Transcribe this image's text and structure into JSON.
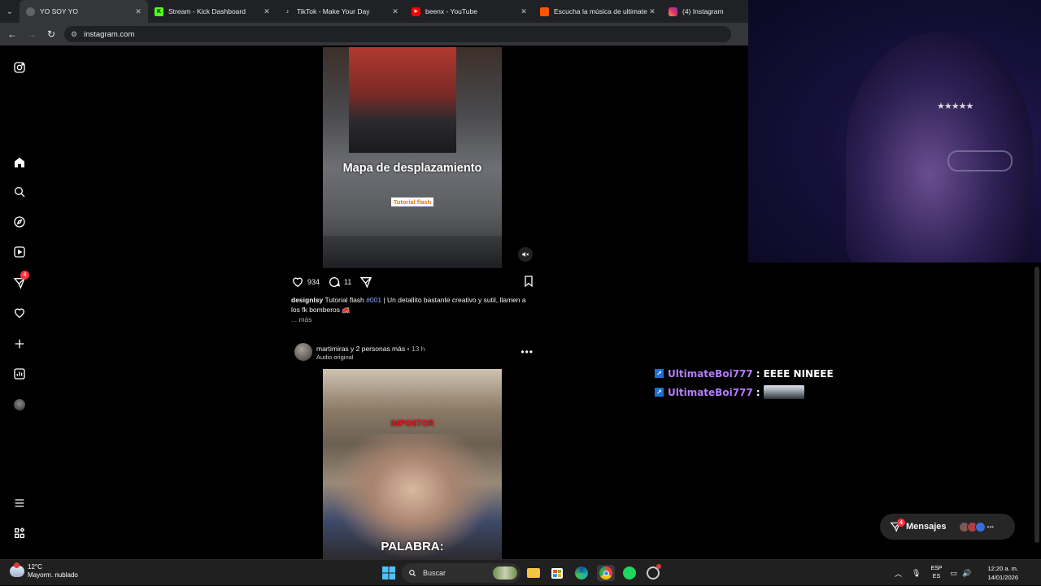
{
  "browser": {
    "tabs": [
      {
        "label": "YO SOY YO",
        "active": true
      },
      {
        "label": "Stream - Kick Dashboard",
        "active": false
      },
      {
        "label": "TikTok - Make Your Day",
        "active": false
      },
      {
        "label": "beenx - YouTube",
        "active": false
      },
      {
        "label": "Escucha la música de ultimateb",
        "active": false
      },
      {
        "label": "(4) Instagram",
        "active": false
      }
    ],
    "url": "instagram.com"
  },
  "ig_nav": {
    "notifications_badge": "4"
  },
  "post1": {
    "overlay_title": "Mapa de desplazamiento",
    "overlay_subtitle": "Tutorial flash",
    "likes": "934",
    "comments": "11",
    "caption_user": "designlsy",
    "caption_text_1": "Tutorial flash",
    "caption_tag": "#001",
    "caption_text_2": "| Un detallito bastante creativo y sutil, llamen a los fk bomberos 🚒",
    "more": "... más"
  },
  "post2": {
    "user": "martimiras y 2 personas más",
    "time": "• 13 h",
    "audio": "Audio original",
    "overlay_top": "IMPOSTOR",
    "overlay_bottom": "PALABRA:"
  },
  "chat": [
    {
      "user": "UltimateBoi777",
      "message": "EEEE NINEEE",
      "emote": false
    },
    {
      "user": "UltimateBoi777",
      "message": "",
      "emote": true
    }
  ],
  "messages": {
    "label": "Mensajes",
    "badge": "4"
  },
  "taskbar": {
    "temp": "12°C",
    "weather": "Mayorm. nublado",
    "search_placeholder": "Buscar",
    "lang_1": "ESP",
    "lang_2": "ES",
    "time": "12:20 a. m.",
    "date": "14/01/2026"
  },
  "colors": {
    "chat_username": "#b57cff",
    "badge_red": "#ff3040",
    "taskbar": "#202020"
  }
}
